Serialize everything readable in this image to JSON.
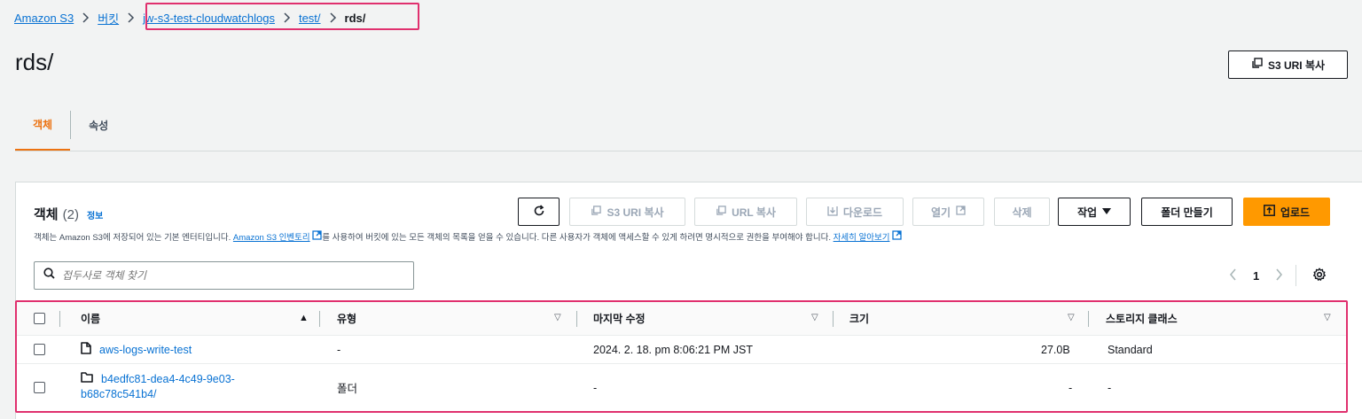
{
  "breadcrumb": {
    "items": [
      "Amazon S3",
      "버킷",
      "jw-s3-test-cloudwatchlogs",
      "test/"
    ],
    "current": "rds/"
  },
  "page": {
    "title": "rds/",
    "copy_uri_label": "S3 URI 복사"
  },
  "tabs": [
    {
      "label": "객체",
      "active": true
    },
    {
      "label": "속성",
      "active": false
    }
  ],
  "objects_panel": {
    "title": "객체",
    "count": "(2)",
    "info_label": "정보",
    "desc_pre": "객체는 Amazon S3에 저장되어 있는 기본 엔터티입니다. ",
    "desc_link1": "Amazon S3 인벤토리",
    "desc_mid": "를 사용하여 버킷에 있는 모든 객체의 목록을 얻을 수 있습니다. 다른 사용자가 객체에 액세스할 수 있게 하려면 명시적으로 권한을 부여해야 합니다. ",
    "desc_link2": "자세히 알아보기",
    "toolbar": {
      "copy_s3_uri": "S3 URI 복사",
      "copy_url": "URL 복사",
      "download": "다운로드",
      "open": "열기",
      "delete": "삭제",
      "actions": "작업",
      "create_folder": "폴더 만들기",
      "upload": "업로드"
    },
    "search": {
      "placeholder": "접두사로 객체 찾기",
      "value": ""
    },
    "pagination": {
      "current_page": "1"
    }
  },
  "table": {
    "columns": [
      "이름",
      "유형",
      "마지막 수정",
      "크기",
      "스토리지 클래스"
    ],
    "rows": [
      {
        "name": "aws-logs-write-test",
        "kind": "file",
        "type": "-",
        "modified": "2024. 2. 18. pm 8:06:21 PM JST",
        "size": "27.0B",
        "storage_class": "Standard"
      },
      {
        "name_line1": "b4edfc81-dea4-4c49-9e03-",
        "name_line2": "b68c78c541b4/",
        "kind": "folder",
        "type": "폴더",
        "modified": "-",
        "size": "-",
        "storage_class": "-"
      }
    ]
  },
  "colors": {
    "accent": "#ec7211",
    "link": "#0972d3",
    "primary_button": "#ff9900",
    "highlight": "#e0306e"
  }
}
